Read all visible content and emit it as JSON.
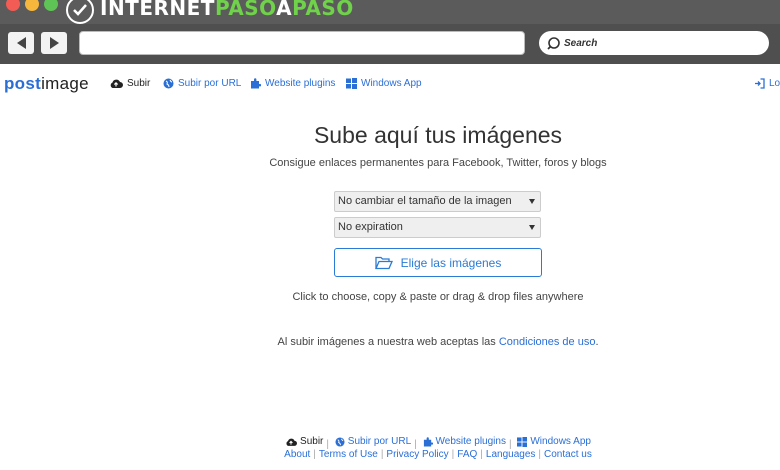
{
  "browser": {
    "watermark": {
      "part_a": "INTERNET",
      "part_b": "PASO",
      "part_c": "A",
      "part_d": "PASO"
    },
    "search_placeholder": "Search"
  },
  "header": {
    "logo_post": "post",
    "logo_image": "image",
    "menu": {
      "upload": "Subir",
      "upload_url": "Subir por URL",
      "plugins": "Website plugins",
      "windows": "Windows App",
      "login": "Log"
    }
  },
  "main": {
    "title": "Sube aquí tus imágenes",
    "subtitle": "Consigue enlaces permanentes para Facebook, Twitter, foros y blogs",
    "resize_select": "No cambiar el tamaño de la imagen",
    "expiration_select": "No expiration",
    "choose_button": "Elige las imágenes",
    "hint": "Click to choose, copy & paste or drag & drop files anywhere",
    "terms_prefix": "Al subir imágenes a nuestra web aceptas las ",
    "terms_link": "Condiciones de uso",
    "terms_suffix": "."
  },
  "footer": {
    "row1": {
      "upload": "Subir",
      "upload_url": "Subir por URL",
      "plugins": "Website plugins",
      "windows": "Windows App"
    },
    "row2": {
      "about": "About",
      "terms": "Terms of Use",
      "privacy": "Privacy Policy",
      "faq": "FAQ",
      "languages": "Languages",
      "contact": "Contact us"
    }
  },
  "colors": {
    "accent": "#2a6fd6",
    "watermark_green": "#6fd24a",
    "chrome_dark": "#4f4f4f"
  }
}
